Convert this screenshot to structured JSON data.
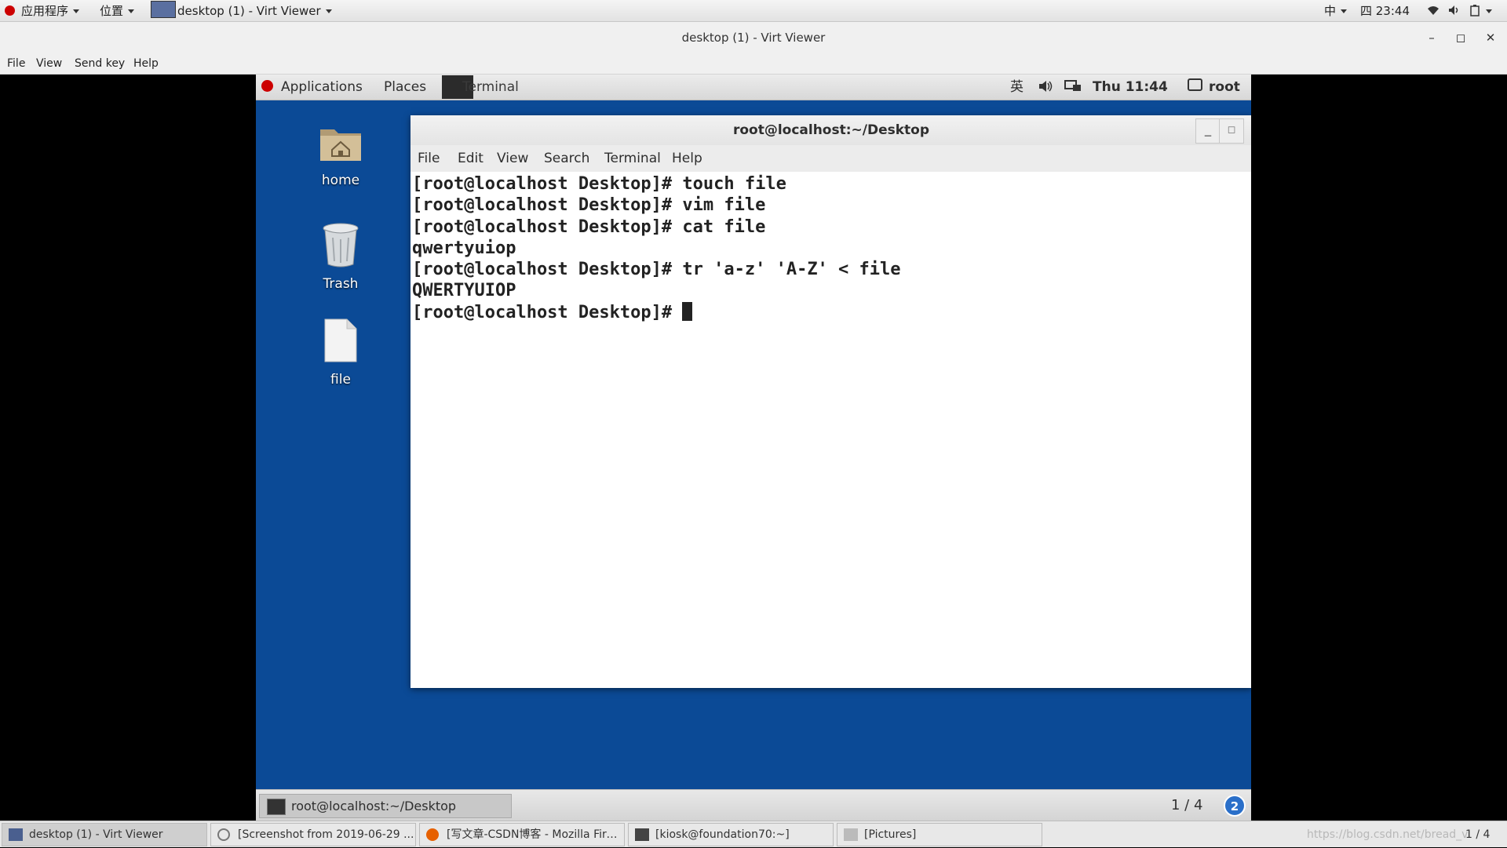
{
  "host_panel": {
    "apps": "应用程序",
    "places": "位置",
    "window_title": "desktop (1) - Virt Viewer",
    "input_method": "中",
    "clock": "四 23:44"
  },
  "viewer": {
    "title": "desktop (1) - Virt Viewer",
    "menu": [
      "File",
      "View",
      "Send key",
      "Help"
    ]
  },
  "guest": {
    "panel": {
      "applications": "Applications",
      "places": "Places",
      "active_window": "Terminal",
      "input_method": "英",
      "clock": "Thu 11:44",
      "user": "root"
    },
    "desktop_icons": [
      {
        "label": "home",
        "icon": "folder-home-icon"
      },
      {
        "label": "Trash",
        "icon": "trash-icon"
      },
      {
        "label": "file",
        "icon": "file-icon"
      }
    ],
    "terminal": {
      "title": "root@localhost:~/Desktop",
      "menu": [
        "File",
        "Edit",
        "View",
        "Search",
        "Terminal",
        "Help"
      ],
      "lines": [
        "[root@localhost Desktop]# touch file",
        "[root@localhost Desktop]# vim file",
        "[root@localhost Desktop]# cat file",
        "qwertyuiop",
        "[root@localhost Desktop]# tr 'a-z' 'A-Z' < file",
        "QWERTYUIOP",
        "[root@localhost Desktop]# "
      ]
    },
    "taskbar": {
      "window": "root@localhost:~/Desktop",
      "workspace": "1 / 4",
      "notifications": "2"
    }
  },
  "host_taskbar": {
    "items": [
      "desktop (1) - Virt Viewer",
      "[Screenshot from 2019-06-29 ...",
      "[写文章-CSDN博客 - Mozilla Firef...",
      "[kiosk@foundation70:~]",
      "[Pictures]"
    ],
    "watermark": "https://blog.csdn.net/bread_v",
    "workspace": "1 / 4"
  }
}
